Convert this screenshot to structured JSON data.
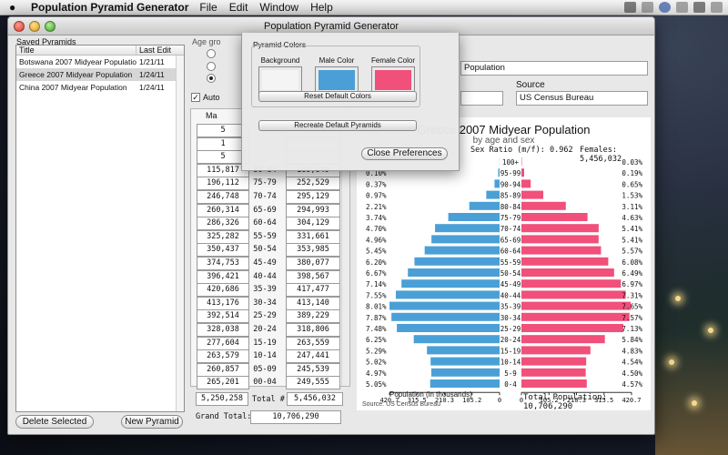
{
  "menubar": {
    "apple_icon": "apple-logo-icon",
    "app_name": "Population Pyramid Generator",
    "items": [
      "File",
      "Edit",
      "Window",
      "Help"
    ]
  },
  "window": {
    "title": "Population Pyramid Generator"
  },
  "saved_pyramids": {
    "section_label": "Saved Pyramids",
    "col_title": "Title",
    "col_last_edit": "Last Edit",
    "rows": [
      {
        "title": "Botswana 2007 Midyear Population",
        "date": "1/21/11",
        "selected": false
      },
      {
        "title": "Greece 2007 Midyear Population",
        "date": "1/24/11",
        "selected": true
      },
      {
        "title": "China 2007 Midyear Population",
        "date": "1/24/11",
        "selected": false
      }
    ],
    "delete_label": "Delete Selected",
    "new_label": "New Pyramid"
  },
  "controls": {
    "age_group_label": "Age gro",
    "auto_label": "Auto",
    "title_value": "Population",
    "source_label": "Source",
    "source_value": "US Census Bureau",
    "col_male": "Ma"
  },
  "table": {
    "rows": [
      {
        "male": "5",
        "age": "",
        "female": ""
      },
      {
        "male": "1",
        "age": "",
        "female": ""
      },
      {
        "male": "5",
        "age": "",
        "female": ""
      },
      {
        "male": "115,817",
        "age": "80-84",
        "female": "169,649"
      },
      {
        "male": "196,112",
        "age": "75-79",
        "female": "252,529"
      },
      {
        "male": "246,748",
        "age": "70-74",
        "female": "295,129"
      },
      {
        "male": "260,314",
        "age": "65-69",
        "female": "294,993"
      },
      {
        "male": "286,326",
        "age": "60-64",
        "female": "304,129"
      },
      {
        "male": "325,282",
        "age": "55-59",
        "female": "331,661"
      },
      {
        "male": "350,437",
        "age": "50-54",
        "female": "353,985"
      },
      {
        "male": "374,753",
        "age": "45-49",
        "female": "380,077"
      },
      {
        "male": "396,421",
        "age": "40-44",
        "female": "398,567"
      },
      {
        "male": "420,686",
        "age": "35-39",
        "female": "417,477"
      },
      {
        "male": "413,176",
        "age": "30-34",
        "female": "413,140"
      },
      {
        "male": "392,514",
        "age": "25-29",
        "female": "389,229"
      },
      {
        "male": "328,038",
        "age": "20-24",
        "female": "318,806"
      },
      {
        "male": "277,604",
        "age": "15-19",
        "female": "263,559"
      },
      {
        "male": "263,579",
        "age": "10-14",
        "female": "247,441"
      },
      {
        "male": "260,857",
        "age": "05-09",
        "female": "245,539"
      },
      {
        "male": "265,201",
        "age": "00-04",
        "female": "249,555"
      }
    ],
    "male_total": "5,250,258",
    "total_label": "Total #",
    "female_total": "5,456,032",
    "grand_label": "Grand Total:",
    "grand_value": "10,706,290"
  },
  "popup": {
    "box_title": "Pyramid Colors",
    "swatches": [
      {
        "label": "Background",
        "color": "#f4f4f4"
      },
      {
        "label": "Male Color",
        "color": "#4aa0d6"
      },
      {
        "label": "Female Color",
        "color": "#f0507a"
      }
    ],
    "reset_label": "Reset Default Colors",
    "recreate_label": "Recreate Default Pyramids",
    "close_label": "Close Preferences"
  },
  "chart_data": {
    "type": "bar",
    "orientation": "horizontal-pyramid",
    "title": "Greece 2007 Midyear Population",
    "subtitle": "by age and sex",
    "sex_ratio_text": "Sex Ratio (m/f): 0.962",
    "females_text": "Females: 5,456,032",
    "total_text": "Total Population: 10,706,290",
    "xlabel": "Population (in thousands)",
    "source_text": "Source: US Census Bureau",
    "male_color": "#4aa0d6",
    "female_color": "#f0507a",
    "xlim": [
      0,
      420.7
    ],
    "x_ticks": [
      "420.7",
      "315.5",
      "210.3",
      "105.2",
      "0",
      "0",
      "105.2",
      "210.3",
      "315.5",
      "420.7"
    ],
    "categories": [
      "100+",
      "95-99",
      "90-94",
      "85-89",
      "80-84",
      "75-79",
      "70-74",
      "65-69",
      "60-64",
      "55-59",
      "50-54",
      "45-49",
      "40-44",
      "35-39",
      "30-34",
      "25-29",
      "20-24",
      "15-19",
      "10-14",
      "5-9",
      "0-4"
    ],
    "male_pct_labels": [
      "",
      "0.10%",
      "0.37%",
      "0.97%",
      "2.21%",
      "3.74%",
      "4.70%",
      "4.96%",
      "5.45%",
      "6.20%",
      "6.67%",
      "7.14%",
      "7.55%",
      "8.01%",
      "7.87%",
      "7.48%",
      "6.25%",
      "5.29%",
      "5.02%",
      "4.97%",
      "5.05%"
    ],
    "female_pct_labels": [
      "0.03%",
      "0.19%",
      "0.65%",
      "1.53%",
      "3.11%",
      "4.63%",
      "5.41%",
      "5.41%",
      "5.57%",
      "6.08%",
      "6.49%",
      "6.97%",
      "7.31%",
      "7.65%",
      "7.57%",
      "7.13%",
      "5.84%",
      "4.83%",
      "4.54%",
      "4.50%",
      "4.57%"
    ],
    "series": [
      {
        "name": "Male",
        "values": [
          0.5,
          5.2,
          19.4,
          50.9,
          115.8,
          196.1,
          246.7,
          260.3,
          286.3,
          325.3,
          350.4,
          374.8,
          396.4,
          420.7,
          413.2,
          392.5,
          328.0,
          277.6,
          263.6,
          260.9,
          265.2
        ]
      },
      {
        "name": "Female",
        "values": [
          1.6,
          10.4,
          35.5,
          83.5,
          169.6,
          252.5,
          295.1,
          295.0,
          304.1,
          331.7,
          354.0,
          380.1,
          398.6,
          417.5,
          413.1,
          389.2,
          318.8,
          263.6,
          247.4,
          245.5,
          249.6
        ]
      }
    ]
  }
}
